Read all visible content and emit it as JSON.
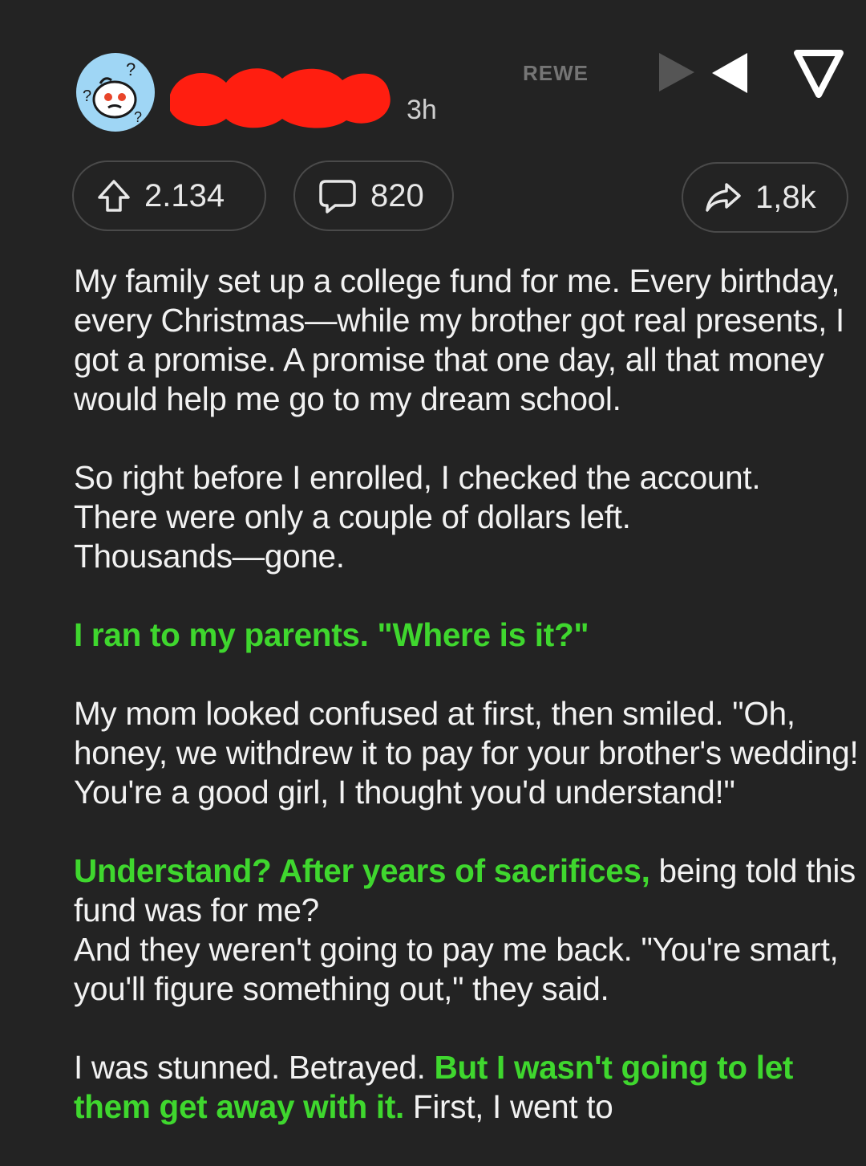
{
  "post": {
    "time_ago": "3h",
    "watermark": "REWE"
  },
  "actions": {
    "upvotes": "2.134",
    "comments": "820",
    "shares": "1,8k"
  },
  "colors": {
    "background": "#232323",
    "highlight": "#3fd72e",
    "redaction": "#ff1e10"
  },
  "icons": [
    "avatar",
    "play-icon",
    "back-triangle-icon",
    "down-triangle-icon",
    "upvote-icon",
    "comment-icon",
    "share-icon"
  ],
  "body": {
    "p1": "My family set up a college fund for me. Every birthday, every Christmas—while my brother got real presents, I got a promise. A promise that one day, all that money would help me go to my dream school.",
    "p2_line1": "So right before I enrolled, I checked the account.",
    "p2_line2": "There were only a couple of dollars left.",
    "p2_line3": "Thousands—gone.",
    "p3_highlight": "I ran to my parents. \"Where is it?\"",
    "p4": "My mom looked confused at first, then smiled. \"Oh, honey, we withdrew it to pay for your brother's wedding! You're a good girl, I thought you'd understand!\"",
    "p5_highlight": "Understand? After years of sacrifices,",
    "p5_rest": " being told this fund was for me?",
    "p5_line2": "And they weren't going to pay me back. \"You're smart, you'll figure something out,\" they said.",
    "p6_start": "I was stunned. Betrayed. ",
    "p6_highlight": "But I wasn't going to let them get away with it.",
    "p6_rest": " First, I went to"
  }
}
